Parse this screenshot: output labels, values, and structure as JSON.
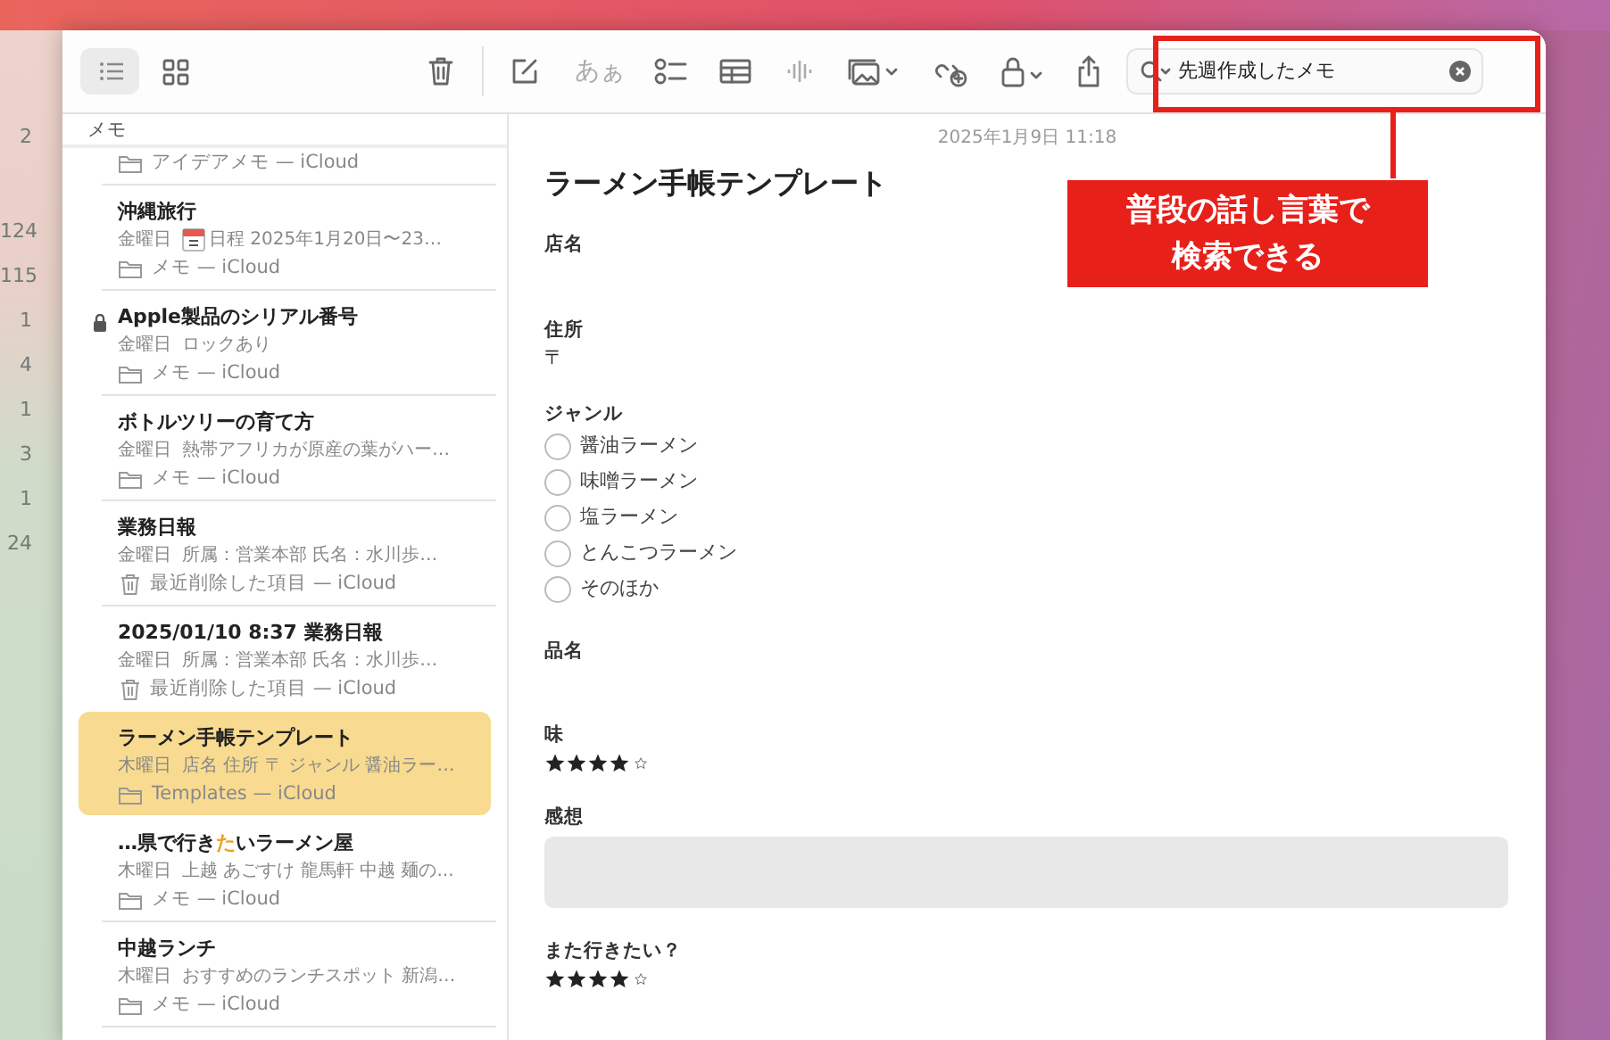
{
  "sidebar_counts": [
    "2",
    "124",
    "115",
    "1",
    "4",
    "1",
    "3",
    "1",
    "24"
  ],
  "toolbar": {
    "view_buttons": [
      {
        "kind": "list",
        "selected": true
      },
      {
        "kind": "grid",
        "selected": false
      }
    ],
    "format_label": "あぁ"
  },
  "search": {
    "value": "先週作成したメモ"
  },
  "note_list": {
    "header": "メモ",
    "notes": [
      {
        "location": "アイデアメモ — iCloud",
        "deleted": false,
        "selected": false
      },
      {
        "title": "沖縄旅行",
        "day": "金曜日",
        "preview": "日程 2025年1月20日〜23…",
        "has_calendar": true,
        "location": "メモ — iCloud",
        "deleted": false,
        "locked": false,
        "selected": false
      },
      {
        "title": "Apple製品のシリアル番号",
        "day": "金曜日",
        "preview": "ロックあり",
        "has_calendar": false,
        "location": "メモ — iCloud",
        "deleted": false,
        "locked": true,
        "selected": false
      },
      {
        "title": "ボトルツリーの育て方",
        "day": "金曜日",
        "preview": "熱帯アフリカが原産の葉がハー…",
        "has_calendar": false,
        "location": "メモ — iCloud",
        "deleted": false,
        "locked": false,
        "selected": false
      },
      {
        "title": "業務日報",
        "day": "金曜日",
        "preview": "所属：営業本部 氏名：水川歩…",
        "has_calendar": false,
        "location": "最近削除した項目 — iCloud",
        "deleted": true,
        "locked": false,
        "selected": false
      },
      {
        "title": "2025/01/10 8:37 業務日報",
        "day": "金曜日",
        "preview": "所属：営業本部 氏名：水川歩…",
        "has_calendar": false,
        "location": "最近削除した項目 — iCloud",
        "deleted": true,
        "locked": false,
        "selected": false
      },
      {
        "title": "ラーメン手帳テンプレート",
        "day": "木曜日",
        "preview": "店名 住所 〒 ジャンル 醤油ラー…",
        "has_calendar": false,
        "location": "Templates — iCloud",
        "deleted": false,
        "locked": false,
        "selected": true
      },
      {
        "title_segments": [
          {
            "text": "…県で行き",
            "match": false
          },
          {
            "text": "た",
            "match": true
          },
          {
            "text": "いラーメン屋",
            "match": false
          }
        ],
        "day": "木曜日",
        "preview": "上越 あごすけ 龍馬軒 中越 麺の...",
        "has_calendar": false,
        "location": "メモ — iCloud",
        "deleted": false,
        "locked": false,
        "selected": false
      },
      {
        "title": "中越ランチ",
        "day": "木曜日",
        "preview": "おすすめのランチスポット 新潟…",
        "has_calendar": false,
        "location": "メモ — iCloud",
        "deleted": false,
        "locked": false,
        "selected": false
      }
    ]
  },
  "note": {
    "date": "2025年1月9日 11:18",
    "title": "ラーメン手帳テンプレート",
    "fields": [
      {
        "kind": "text",
        "label": "店名"
      },
      {
        "kind": "text",
        "label": "住所",
        "value": "〒"
      },
      {
        "kind": "choices",
        "label": "ジャンル",
        "options": [
          {
            "label": "醤油ラーメン",
            "selected": false
          },
          {
            "label": "味噌ラーメン",
            "selected": false
          },
          {
            "label": "塩ラーメン",
            "selected": false
          },
          {
            "label": "とんこつラーメン",
            "selected": false
          },
          {
            "label": "そのほか",
            "selected": false
          }
        ]
      },
      {
        "kind": "text",
        "label": "品名"
      },
      {
        "kind": "stars",
        "label": "味",
        "stars": 4
      },
      {
        "kind": "box",
        "label": "感想"
      },
      {
        "kind": "stars",
        "label": "また行きたい？",
        "stars": 4
      }
    ]
  },
  "callout": {
    "lines": [
      "普段の話し言葉で",
      "検索できる"
    ]
  }
}
